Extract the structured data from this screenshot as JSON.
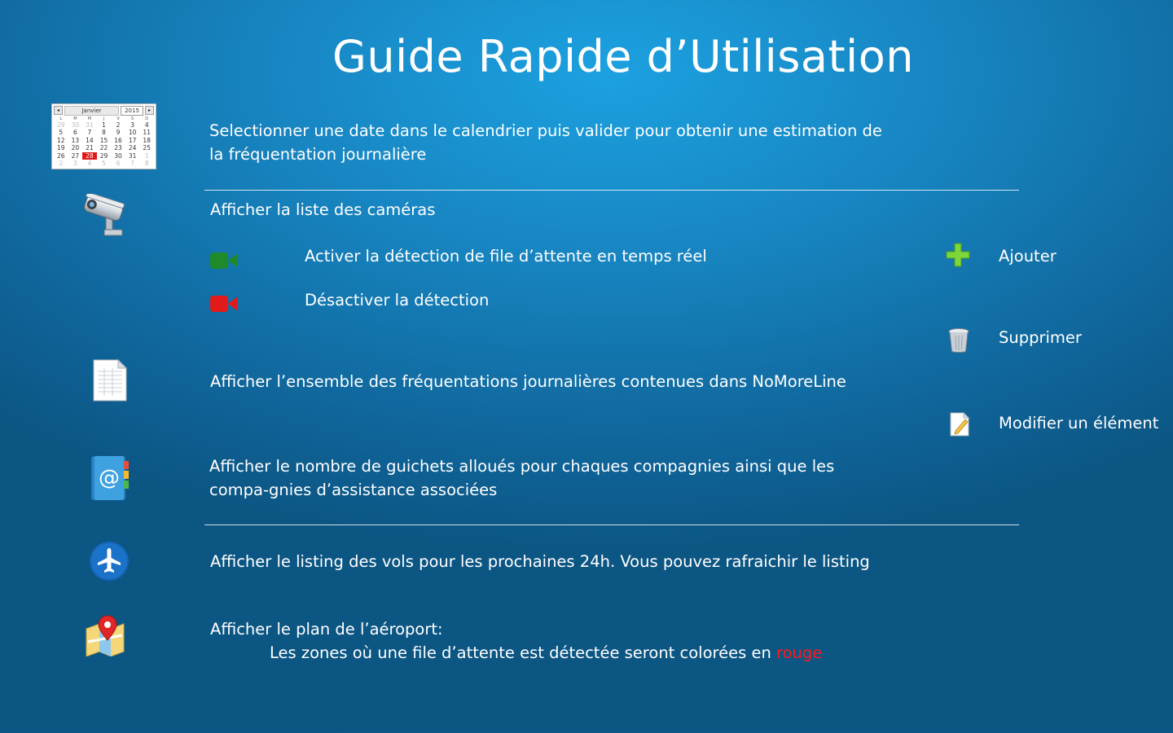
{
  "title": "Guide Rapide d’Utilisation",
  "calendar": {
    "month": "Janvier",
    "year": "2015",
    "prev": "◂",
    "next": "▸",
    "weekdays": [
      "L",
      "M",
      "M",
      "J",
      "V",
      "S",
      "D"
    ],
    "days": [
      {
        "d": "29",
        "dim": true
      },
      {
        "d": "30",
        "dim": true
      },
      {
        "d": "31",
        "dim": true
      },
      {
        "d": "1"
      },
      {
        "d": "2"
      },
      {
        "d": "3"
      },
      {
        "d": "4"
      },
      {
        "d": "5"
      },
      {
        "d": "6"
      },
      {
        "d": "7"
      },
      {
        "d": "8"
      },
      {
        "d": "9"
      },
      {
        "d": "10"
      },
      {
        "d": "11"
      },
      {
        "d": "12"
      },
      {
        "d": "13"
      },
      {
        "d": "14"
      },
      {
        "d": "15"
      },
      {
        "d": "16"
      },
      {
        "d": "17"
      },
      {
        "d": "18"
      },
      {
        "d": "19"
      },
      {
        "d": "20"
      },
      {
        "d": "21"
      },
      {
        "d": "22"
      },
      {
        "d": "23"
      },
      {
        "d": "24"
      },
      {
        "d": "25"
      },
      {
        "d": "26"
      },
      {
        "d": "27"
      },
      {
        "d": "28",
        "sel": true
      },
      {
        "d": "29"
      },
      {
        "d": "30"
      },
      {
        "d": "31"
      },
      {
        "d": "1",
        "dim": true
      },
      {
        "d": "2",
        "dim": true
      },
      {
        "d": "3",
        "dim": true
      },
      {
        "d": "4",
        "dim": true
      },
      {
        "d": "5",
        "dim": true
      },
      {
        "d": "6",
        "dim": true
      },
      {
        "d": "7",
        "dim": true
      },
      {
        "d": "8",
        "dim": true
      }
    ]
  },
  "sections": {
    "calendar_text": "Selectionner une date dans le calendrier puis valider pour obtenir une estimation de la fréquentation journalière",
    "cameras_text": "Afficher la liste des caméras",
    "activate_text": "Activer la détection de file d’attente en temps réel",
    "deactivate_text": "Désactiver la détection",
    "frequentations_text": "Afficher l’ensemble des fréquentations journalières contenues dans NoMoreLine",
    "guichets_text": "Afficher le nombre de guichets alloués pour chaques compagnies ainsi que les compa-gnies d’assistance associées",
    "flights_text": "Afficher le listing des vols pour les prochaines 24h. Vous pouvez rafraichir le listing",
    "map_text_1": "Afficher le plan de l’aéroport:",
    "map_text_2": "Les zones où une file d’attente est détectée seront colorées en",
    "map_text_red": "rouge"
  },
  "legend": {
    "add": "Ajouter",
    "delete": "Supprimer",
    "edit": "Modifier un élément"
  },
  "icons": {
    "calendar": "calendar-icon",
    "camera": "security-camera-icon",
    "video_on": "video-camera-green-icon",
    "video_off": "video-camera-red-icon",
    "document": "document-icon",
    "address_book": "address-book-icon",
    "plane": "airplane-icon",
    "map": "map-pin-icon",
    "add": "plus-icon",
    "delete": "trash-icon",
    "edit": "edit-note-icon"
  },
  "colors": {
    "background": "#1784c0",
    "green": "#1e8a2a",
    "red": "#e21a1a",
    "highlight_red": "#ff1a1a"
  }
}
